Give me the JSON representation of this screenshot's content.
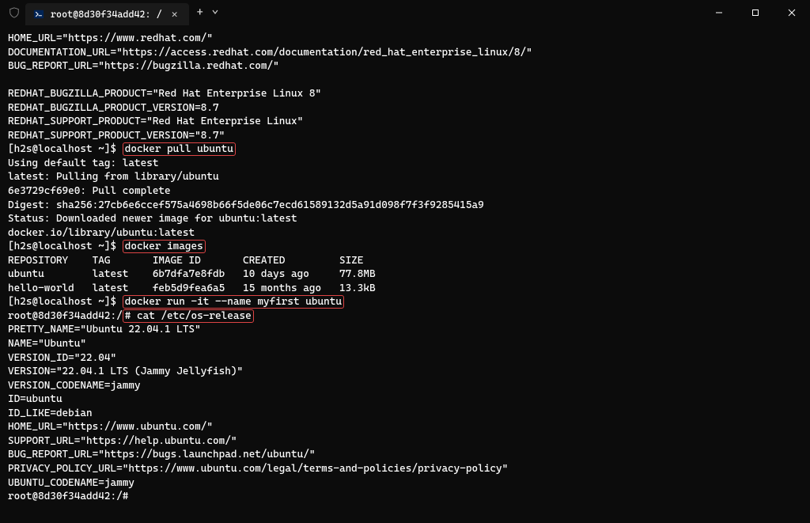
{
  "tab": {
    "title": "root@8d30f34add42: /"
  },
  "lines": [
    {
      "text": "HOME_URL=\"https://www.redhat.com/\""
    },
    {
      "text": "DOCUMENTATION_URL=\"https://access.redhat.com/documentation/red_hat_enterprise_linux/8/\""
    },
    {
      "text": "BUG_REPORT_URL=\"https://bugzilla.redhat.com/\""
    },
    {
      "text": ""
    },
    {
      "text": "REDHAT_BUGZILLA_PRODUCT=\"Red Hat Enterprise Linux 8\""
    },
    {
      "text": "REDHAT_BUGZILLA_PRODUCT_VERSION=8.7"
    },
    {
      "text": "REDHAT_SUPPORT_PRODUCT=\"Red Hat Enterprise Linux\""
    },
    {
      "text": "REDHAT_SUPPORT_PRODUCT_VERSION=\"8.7\""
    },
    {
      "prompt": "[h2s@localhost ~]$ ",
      "cmd": "docker pull ubuntu",
      "highlight": true
    },
    {
      "text": "Using default tag: latest"
    },
    {
      "text": "latest: Pulling from library/ubuntu"
    },
    {
      "text": "6e3729cf69e0: Pull complete"
    },
    {
      "text": "Digest: sha256:27cb6e6ccef575a4698b66f5de06c7ecd61589132d5a91d098f7f3f9285415a9"
    },
    {
      "text": "Status: Downloaded newer image for ubuntu:latest"
    },
    {
      "text": "docker.io/library/ubuntu:latest"
    },
    {
      "prompt": "[h2s@localhost ~]$ ",
      "cmd": "docker images",
      "highlight": true
    },
    {
      "text": "REPOSITORY    TAG       IMAGE ID       CREATED         SIZE"
    },
    {
      "text": "ubuntu        latest    6b7dfa7e8fdb   10 days ago     77.8MB"
    },
    {
      "text": "hello-world   latest    feb5d9fea6a5   15 months ago   13.3kB"
    },
    {
      "prompt": "[h2s@localhost ~]$ ",
      "cmd": "docker run -it --name myfirst ubuntu",
      "highlight": true
    },
    {
      "prompt": "root@8d30f34add42:/",
      "cmd": "# cat /etc/os-release",
      "highlight": true
    },
    {
      "text": "PRETTY_NAME=\"Ubuntu 22.04.1 LTS\""
    },
    {
      "text": "NAME=\"Ubuntu\""
    },
    {
      "text": "VERSION_ID=\"22.04\""
    },
    {
      "text": "VERSION=\"22.04.1 LTS (Jammy Jellyfish)\""
    },
    {
      "text": "VERSION_CODENAME=jammy"
    },
    {
      "text": "ID=ubuntu"
    },
    {
      "text": "ID_LIKE=debian"
    },
    {
      "text": "HOME_URL=\"https://www.ubuntu.com/\""
    },
    {
      "text": "SUPPORT_URL=\"https://help.ubuntu.com/\""
    },
    {
      "text": "BUG_REPORT_URL=\"https://bugs.launchpad.net/ubuntu/\""
    },
    {
      "text": "PRIVACY_POLICY_URL=\"https://www.ubuntu.com/legal/terms-and-policies/privacy-policy\""
    },
    {
      "text": "UBUNTU_CODENAME=jammy"
    },
    {
      "text": "root@8d30f34add42:/#"
    }
  ]
}
